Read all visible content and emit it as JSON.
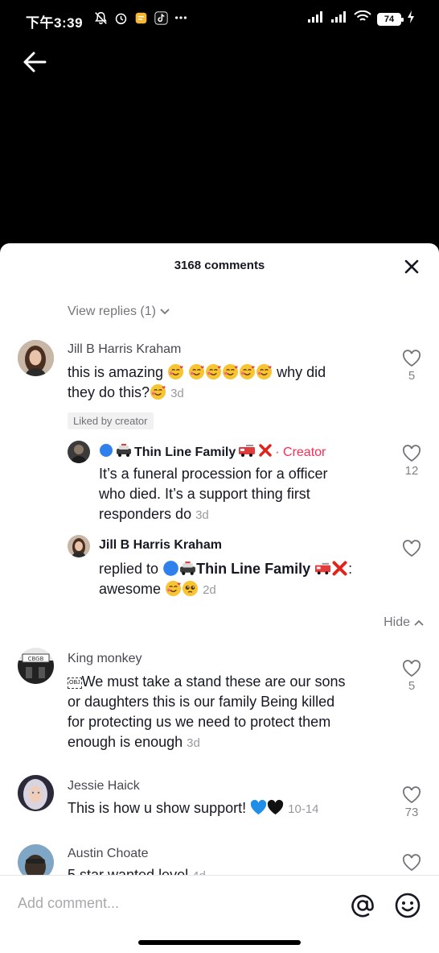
{
  "status_bar": {
    "time": "下午3:39",
    "battery": "74",
    "left_icons": [
      "bell-off-icon",
      "alarm-icon",
      "notes-app-icon",
      "tiktok-icon",
      "more-dots-icon"
    ],
    "right_icons": [
      "signal-icon",
      "signal-icon",
      "wifi-icon",
      "battery-icon",
      "charging-icon"
    ]
  },
  "sheet": {
    "comments_count": "3168 comments",
    "view_replies": "View replies (1)",
    "hide": "Hide",
    "add_comment_placeholder": "Add comment..."
  },
  "comments": [
    {
      "author": "Jill B Harris Kraham",
      "text_line1": "this is amazing",
      "text_after_emoji": "why did",
      "text_line2": "they do this?",
      "time": "3d",
      "likes": "5",
      "badge": "Liked by creator",
      "replies": [
        {
          "author": "Thin Line Family",
          "creator_tag": "· Creator",
          "lines": [
            "It’s a funeral procession for a officer",
            "who died. It’s a support thing first",
            "responders do"
          ],
          "time": "3d",
          "likes": "12"
        },
        {
          "author": "Jill B Harris Kraham",
          "replied_to": "replied to",
          "replied_to_name": "Thin Line Family",
          "text": "awesome",
          "time": "2d",
          "likes": ""
        }
      ]
    },
    {
      "author": "King monkey",
      "lines": [
        "We must take a stand these are our sons",
        "or daughters this is our family Being killed",
        "for protecting us we need to protect them",
        "enough is enough"
      ],
      "time": "3d",
      "likes": "5"
    },
    {
      "author": "Jessie Haick",
      "text": "This is how u show support!",
      "time": "10-14",
      "likes": "73"
    },
    {
      "author": "Austin Choate",
      "text": "5 star wanted level",
      "time": "4d",
      "likes": ""
    }
  ]
}
